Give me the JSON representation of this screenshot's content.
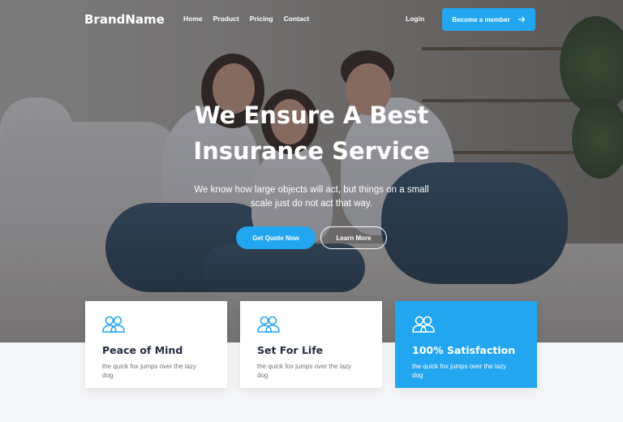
{
  "nav": {
    "brand": "BrandName",
    "links": [
      "Home",
      "Product",
      "Pricing",
      "Contact"
    ],
    "login": "Login",
    "cta": "Become a member",
    "cta_icon": "arrow-right-icon"
  },
  "hero": {
    "headline_line1": "We Ensure A Best",
    "headline_line2": "Insurance Service",
    "subtext": "We know how large objects will act, but things on a small scale just do not act that way.",
    "primary_button": "Get Quote Now",
    "secondary_button": "Learn More"
  },
  "features": [
    {
      "icon": "users-icon",
      "title": "Peace of Mind",
      "description": "the quick fox jumps over the lazy dog",
      "active": false
    },
    {
      "icon": "users-icon",
      "title": "Set For Life",
      "description": "the quick fox jumps over the lazy dog",
      "active": false
    },
    {
      "icon": "users-icon",
      "title": "100% Satisfaction",
      "description": "the quick fox jumps over the lazy dog",
      "active": true
    }
  ],
  "colors": {
    "accent": "#23a6f0",
    "heading": "#252b42",
    "muted": "#737373"
  }
}
